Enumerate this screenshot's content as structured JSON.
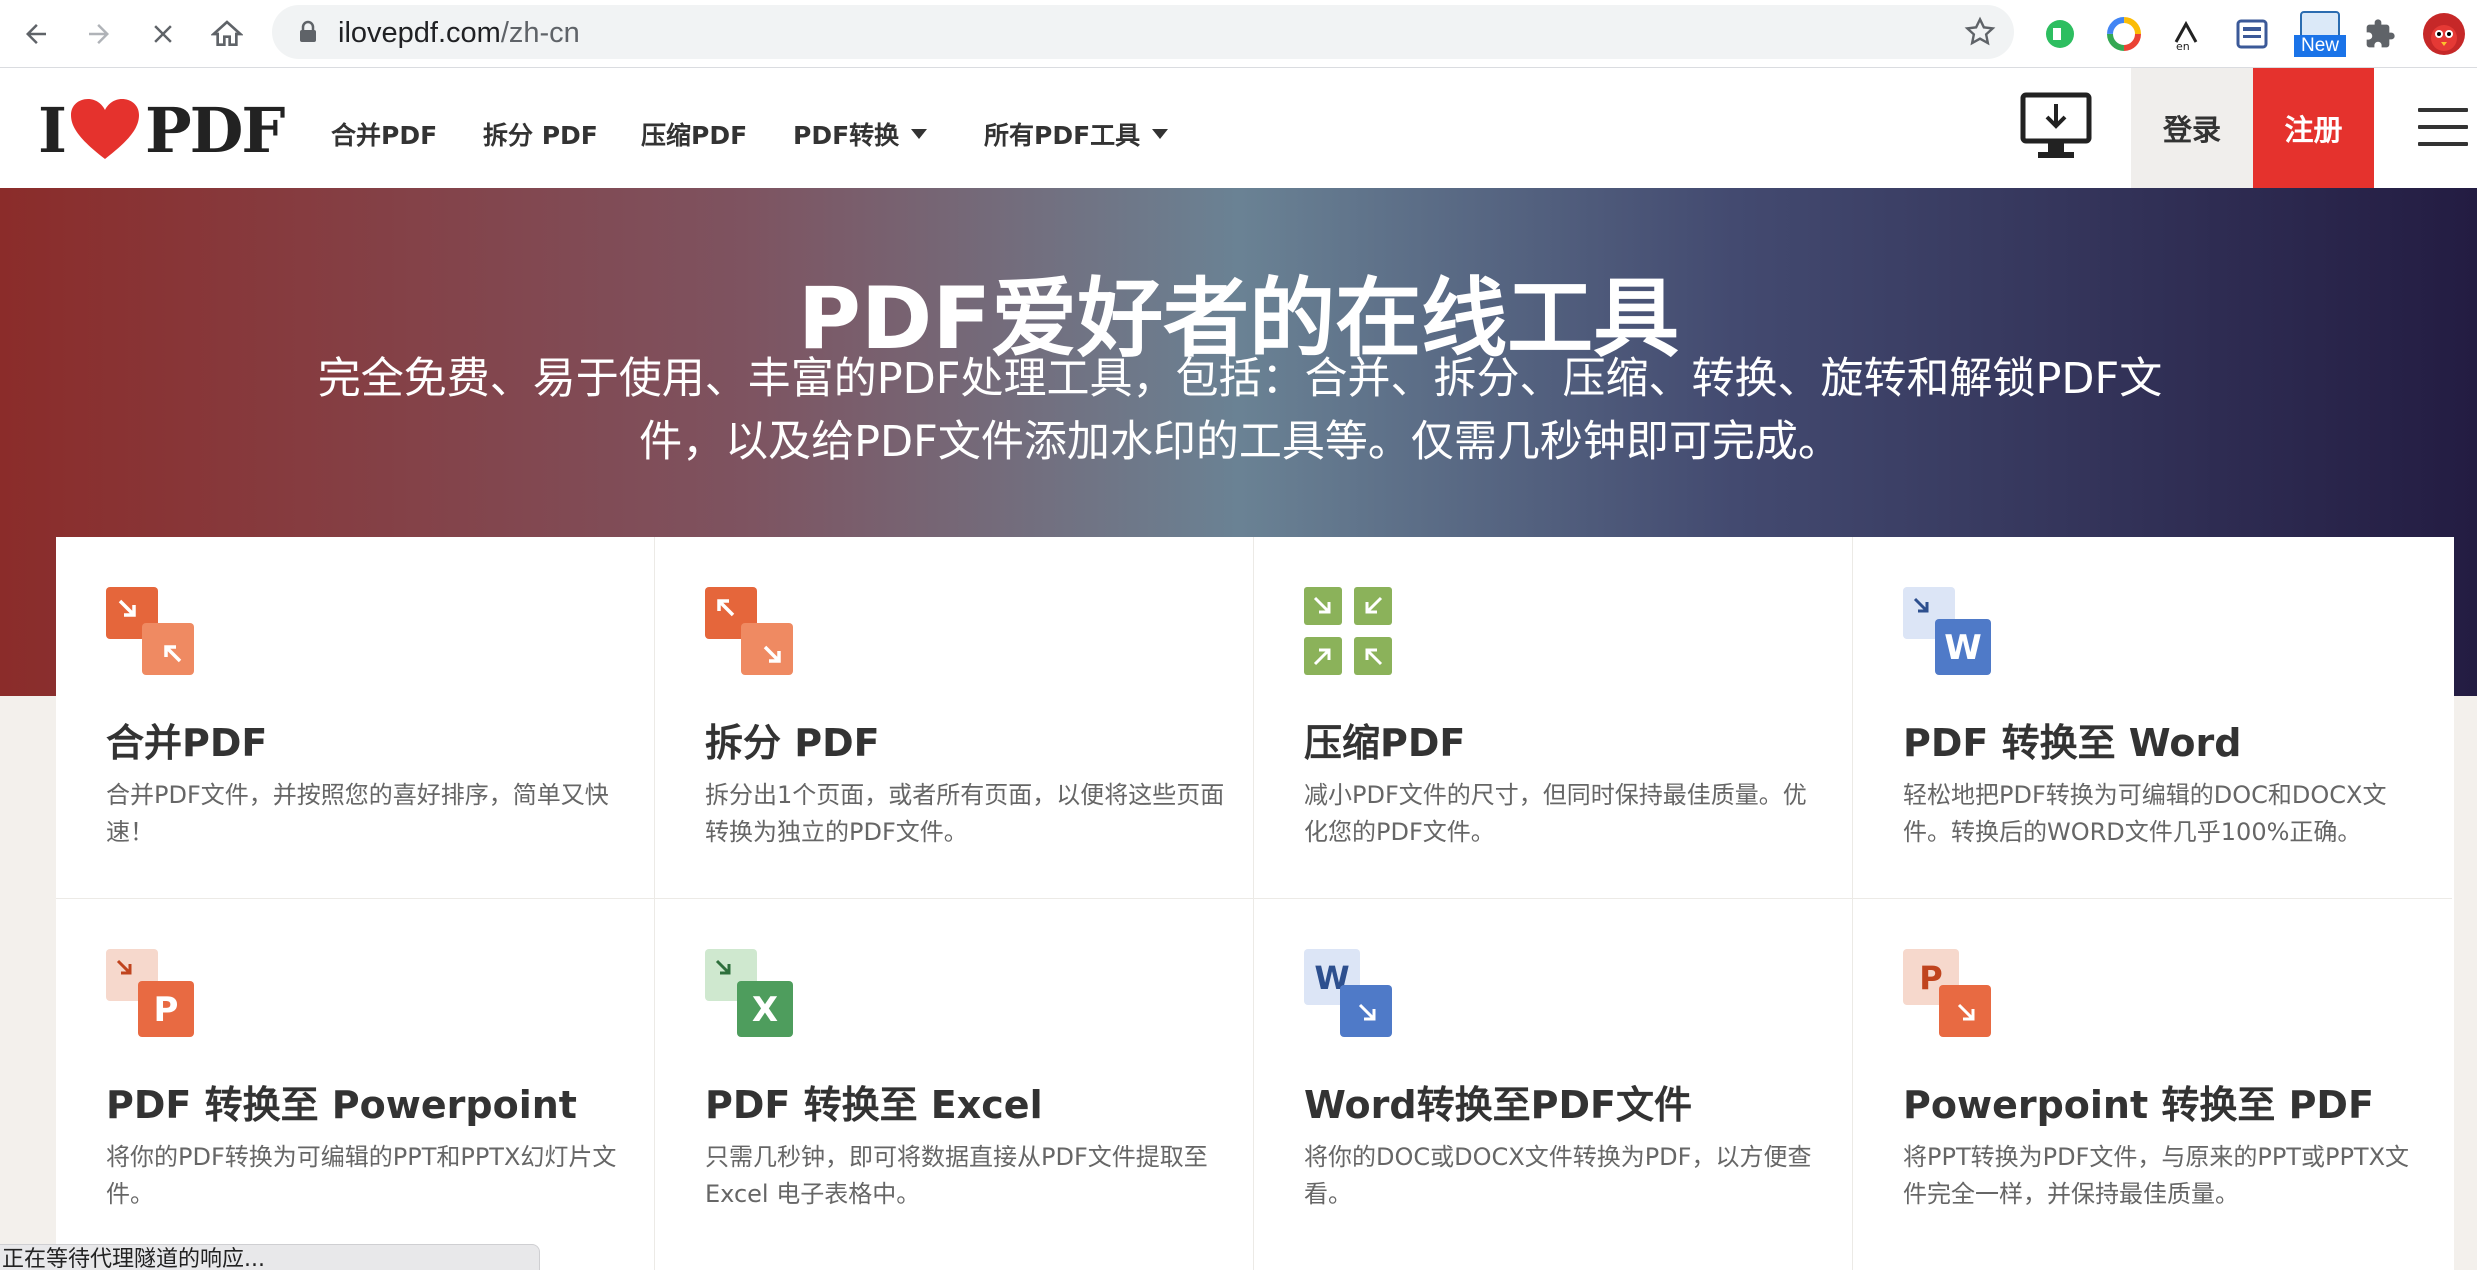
{
  "browser": {
    "url_host": "ilovepdf.com",
    "url_path": "/zh-cn",
    "new_badge": "New",
    "status_text": "正在等待代理隧道的响应..."
  },
  "header": {
    "logo_left": "I",
    "logo_right": "PDF",
    "nav": [
      "合并PDF",
      "拆分 PDF",
      "压缩PDF",
      "PDF转换",
      "所有PDF工具"
    ],
    "login": "登录",
    "signup": "注册"
  },
  "hero": {
    "title": "PDF爱好者的在线工具",
    "subtitle_line1": "完全免费、易于使用、丰富的PDF处理工具，包括：合并、拆分、压缩、转换、旋转和解锁PDF文",
    "subtitle_line2": "件，以及给PDF文件添加水印的工具等。仅需几秒钟即可完成。"
  },
  "tools": [
    {
      "title": "合并PDF",
      "desc": "合并PDF文件，并按照您的喜好排序，简单又快速！",
      "icon": "merge-pdf-icon"
    },
    {
      "title": "拆分 PDF",
      "desc": "拆分出1个页面，或者所有页面，以便将这些页面转换为独立的PDF文件。",
      "icon": "split-pdf-icon"
    },
    {
      "title": "压缩PDF",
      "desc": "减小PDF文件的尺寸，但同时保持最佳质量。优化您的PDF文件。",
      "icon": "compress-pdf-icon"
    },
    {
      "title": "PDF 转换至 Word",
      "desc": "轻松地把PDF转换为可编辑的DOC和DOCX文件。转换后的WORD文件几乎100%正确。",
      "icon": "pdf-to-word-icon"
    },
    {
      "title": "PDF 转换至 Powerpoint",
      "desc": "将你的PDF转换为可编辑的PPT和PPTX幻灯片文件。",
      "icon": "pdf-to-powerpoint-icon"
    },
    {
      "title": "PDF 转换至 Excel",
      "desc": "只需几秒钟，即可将数据直接从PDF文件提取至Excel 电子表格中。",
      "icon": "pdf-to-excel-icon"
    },
    {
      "title": "Word转换至PDF文件",
      "desc": "将你的DOC或DOCX文件转换为PDF，以方便查看。",
      "icon": "word-to-pdf-icon"
    },
    {
      "title": "Powerpoint 转换至 PDF",
      "desc": "将PPT转换为PDF文件，与原来的PPT或PPTX文件完全一样，并保持最佳质量。",
      "icon": "powerpoint-to-pdf-icon"
    }
  ],
  "colors": {
    "brand_red": "#e5322d",
    "merge_orange": "#e5663b",
    "compress_green": "#8bb25a",
    "word_blue": "#4f7ac8",
    "excel_green": "#4e9d5d",
    "ppt_orange": "#e86a42"
  }
}
